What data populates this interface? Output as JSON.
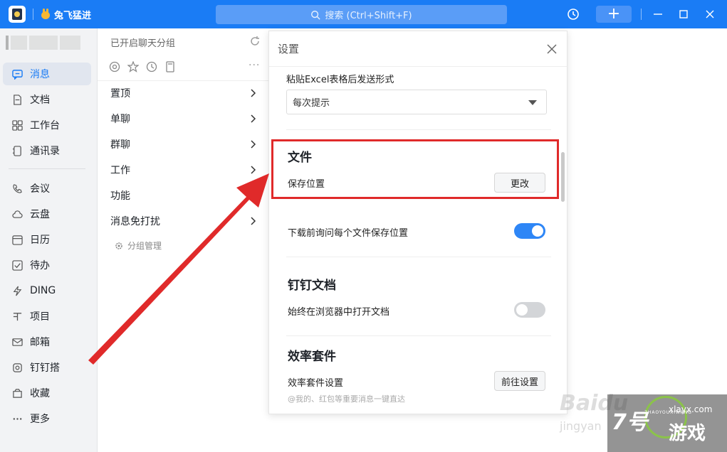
{
  "titlebar": {
    "org_name": "兔飞猛进",
    "search_placeholder": "搜索 (Ctrl+Shift+F)"
  },
  "nav": {
    "items": [
      {
        "label": "消息",
        "icon": "chat-icon",
        "active": true
      },
      {
        "label": "文档",
        "icon": "document-icon"
      },
      {
        "label": "工作台",
        "icon": "grid-icon"
      },
      {
        "label": "通讯录",
        "icon": "contacts-icon"
      },
      {
        "label": "会议",
        "icon": "phone-icon"
      },
      {
        "label": "云盘",
        "icon": "cloud-icon"
      },
      {
        "label": "日历",
        "icon": "calendar-icon"
      },
      {
        "label": "待办",
        "icon": "todo-icon"
      },
      {
        "label": "DING",
        "icon": "lightning-icon"
      },
      {
        "label": "项目",
        "icon": "project-icon"
      },
      {
        "label": "邮箱",
        "icon": "mail-icon"
      },
      {
        "label": "钉钉搭",
        "icon": "build-icon"
      },
      {
        "label": "收藏",
        "icon": "favorite-icon"
      },
      {
        "label": "更多",
        "icon": "more-icon"
      }
    ]
  },
  "groups": {
    "title": "已开启聊天分组",
    "more": "···",
    "items": [
      {
        "label": "置顶",
        "has_chevron": true
      },
      {
        "label": "单聊",
        "has_chevron": true
      },
      {
        "label": "群聊",
        "has_chevron": true
      },
      {
        "label": "工作",
        "has_chevron": true
      },
      {
        "label": "功能",
        "has_chevron": false
      },
      {
        "label": "消息免打扰",
        "has_chevron": true
      }
    ],
    "manage_label": "分组管理"
  },
  "settings": {
    "title": "设置",
    "excel_label": "粘贴Excel表格后发送形式",
    "excel_value": "每次提示",
    "file_section": "文件",
    "save_location_label": "保存位置",
    "change_button": "更改",
    "ask_location_label": "下载前询问每个文件保存位置",
    "ask_location_on": true,
    "dingdoc_section": "钉钉文档",
    "open_browser_label": "始终在浏览器中打开文档",
    "open_browser_on": false,
    "efficiency_section": "效率套件",
    "efficiency_label": "效率套件设置",
    "goto_settings_button": "前往设置",
    "efficiency_hint": "@我的、红包等重要消息一键直达"
  },
  "watermark": {
    "baidu": "Baidu",
    "jingyan": "jingyan",
    "badge_mark": "7号",
    "badge_game": "游戏",
    "badge_url": "xlayx.com",
    "badge_sub": "7HAOYOUXIWANG"
  },
  "colors": {
    "brand_blue": "#1a7cf5",
    "highlight_red": "#e02a2a",
    "toggle_on": "#2e86f6"
  }
}
